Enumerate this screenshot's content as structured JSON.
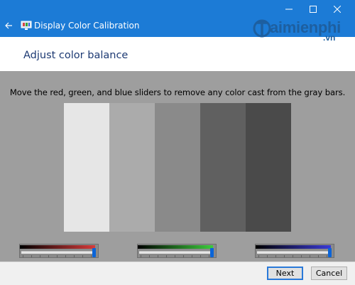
{
  "window": {
    "title": "Display Color Calibration",
    "controls": {
      "minimize": "minimize",
      "maximize": "maximize",
      "close": "close"
    },
    "title_bar_color": "#1c7bd6"
  },
  "page": {
    "heading": "Adjust color balance",
    "instructions": "Move the red, green, and blue sliders to remove any color cast from the gray bars."
  },
  "watermark": {
    "brand": "aimienphi",
    "suffix": ".vn"
  },
  "gray_bars": [
    {
      "color": "#e6e6e6"
    },
    {
      "color": "#ababab"
    },
    {
      "color": "#8a8a8a"
    },
    {
      "color": "#606060"
    },
    {
      "color": "#4a4a4a"
    }
  ],
  "sliders": [
    {
      "name": "red",
      "gradient_end": "#d63a3a",
      "value": 1.0
    },
    {
      "name": "green",
      "gradient_end": "#3ccc3c",
      "value": 1.0
    },
    {
      "name": "blue",
      "gradient_end": "#3a3ad6",
      "value": 1.0
    }
  ],
  "buttons": {
    "next": "Next",
    "cancel": "Cancel"
  },
  "colors": {
    "heading": "#1d3a73",
    "content_background": "#9e9e9e",
    "slider_thumb": "#0a64d8",
    "watermark": "#1d5fa0"
  }
}
